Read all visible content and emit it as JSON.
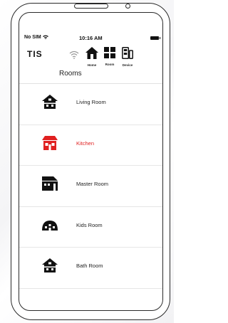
{
  "status": {
    "carrier": "No SIM",
    "time": "10:16 AM"
  },
  "header": {
    "logo": "TIS"
  },
  "nav": [
    {
      "label": "Home",
      "icon": "home-icon"
    },
    {
      "label": "Room",
      "icon": "grid-icon"
    },
    {
      "label": "Device",
      "icon": "device-icon"
    }
  ],
  "page_title": "Rooms",
  "rooms": [
    {
      "label": "Living Room",
      "icon": "house-icon",
      "selected": false
    },
    {
      "label": "Kitchen",
      "icon": "house-icon",
      "selected": true
    },
    {
      "label": "Master Room",
      "icon": "master-room-icon",
      "selected": false
    },
    {
      "label": "Kids Room",
      "icon": "kids-room-icon",
      "selected": false
    },
    {
      "label": "Bath Room",
      "icon": "house-icon",
      "selected": false
    }
  ],
  "colors": {
    "selected": "#e02020",
    "default": "#222222"
  }
}
